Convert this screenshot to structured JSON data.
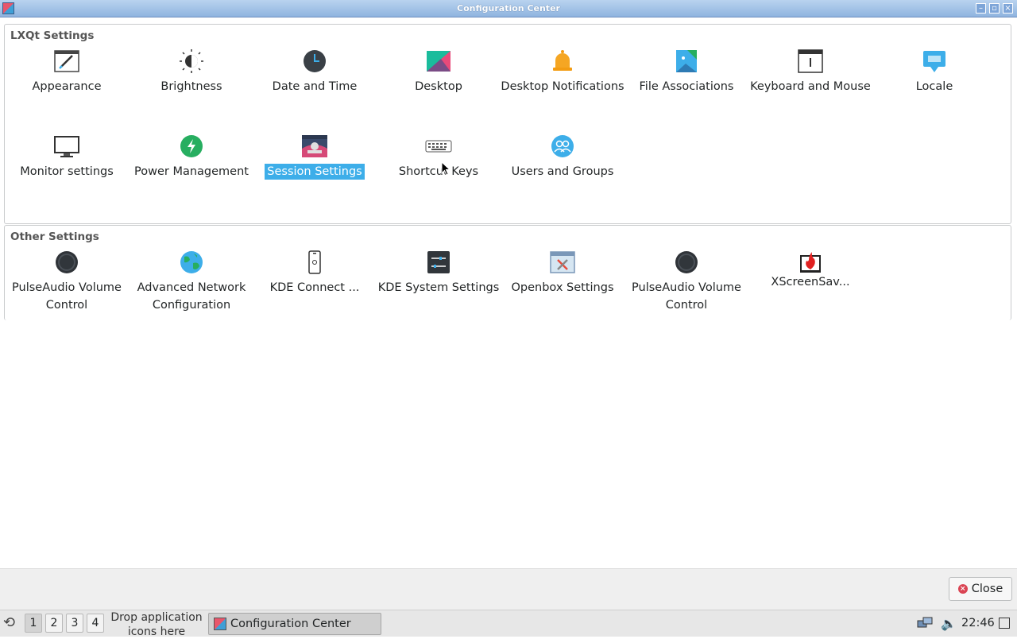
{
  "window": {
    "title": "Configuration Center"
  },
  "groups": [
    {
      "title": "LXQt Settings",
      "items": [
        {
          "label": "Appearance",
          "icon": "appearance-icon"
        },
        {
          "label": "Brightness",
          "icon": "brightness-icon"
        },
        {
          "label": "Date and Time",
          "icon": "clock-icon"
        },
        {
          "label": "Desktop",
          "icon": "desktop-icon"
        },
        {
          "label": "Desktop Notifications",
          "icon": "bell-icon"
        },
        {
          "label": "File Associations",
          "icon": "file-associations-icon"
        },
        {
          "label": "Keyboard and Mouse",
          "icon": "keyboard-mouse-icon"
        },
        {
          "label": "Locale",
          "icon": "locale-icon"
        },
        {
          "label": "Monitor settings",
          "icon": "monitor-icon"
        },
        {
          "label": "Power Management",
          "icon": "power-icon"
        },
        {
          "label": "Session Settings",
          "icon": "session-icon",
          "selected": true
        },
        {
          "label": "Shortcut Keys",
          "icon": "keyboard-icon"
        },
        {
          "label": "Users and Groups",
          "icon": "users-icon"
        }
      ]
    },
    {
      "title": "Other Settings",
      "items": [
        {
          "label": "PulseAudio Volume Control",
          "icon": "volume-knob-icon"
        },
        {
          "label": "Advanced Network Configuration",
          "icon": "globe-icon"
        },
        {
          "label": "KDE Connect ...",
          "icon": "phone-icon"
        },
        {
          "label": "KDE System Settings",
          "icon": "system-settings-icon"
        },
        {
          "label": "Openbox Settings",
          "icon": "openbox-icon"
        },
        {
          "label": "PulseAudio Volume Control",
          "icon": "volume-knob-icon"
        },
        {
          "label": "XScreenSav...",
          "icon": "xscreensaver-icon"
        }
      ]
    }
  ],
  "buttons": {
    "close_label": "Close"
  },
  "panel": {
    "desktops": [
      "1",
      "2",
      "3",
      "4"
    ],
    "active_desktop": "1",
    "quicklaunch_text": "Drop application icons here",
    "task_label": "Configuration Center",
    "clock": "22:46"
  },
  "colors": {
    "selection": "#3daee9",
    "titlebar": "#8fb4df",
    "close_icon": "#da4453"
  }
}
